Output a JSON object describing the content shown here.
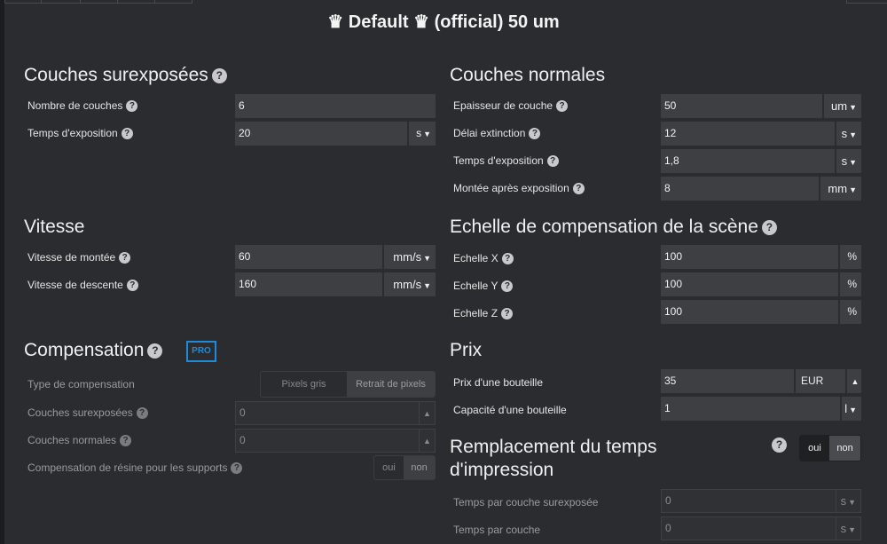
{
  "header": {
    "title": "♛ Default ♛ (official) 50 um"
  },
  "burn_layers": {
    "title": "Couches surexposées",
    "count_label": "Nombre de couches",
    "count_value": "6",
    "exposure_label": "Temps d'exposition",
    "exposure_value": "20",
    "exposure_unit": "s"
  },
  "normal_layers": {
    "title": "Couches normales",
    "thickness_label": "Epaisseur de couche",
    "thickness_value": "50",
    "thickness_unit": "um",
    "off_delay_label": "Délai extinction",
    "off_delay_value": "12",
    "off_delay_unit": "s",
    "exposure_label": "Temps d'exposition",
    "exposure_value": "1,8",
    "exposure_unit": "s",
    "lift_label": "Montée après exposition",
    "lift_value": "8",
    "lift_unit": "mm"
  },
  "speed": {
    "title": "Vitesse",
    "up_label": "Vitesse de montée",
    "up_value": "60",
    "up_unit": "mm/s",
    "down_label": "Vitesse de descente",
    "down_value": "160",
    "down_unit": "mm/s"
  },
  "scale": {
    "title": "Echelle de compensation de la scène",
    "x_label": "Echelle X",
    "x_value": "100",
    "x_unit": "%",
    "y_label": "Echelle Y",
    "y_value": "100",
    "y_unit": "%",
    "z_label": "Echelle Z",
    "z_value": "100",
    "z_unit": "%"
  },
  "compensation": {
    "title": "Compensation",
    "pro_badge": "PRO",
    "type_label": "Type de compensation",
    "type_option_1": "Pixels gris",
    "type_option_2": "Retrait de pixels",
    "burn_label": "Couches surexposées",
    "burn_value": "0",
    "normal_label": "Couches normales",
    "normal_value": "0",
    "support_label": "Compensation de résine pour les supports",
    "support_yes": "oui",
    "support_no": "non"
  },
  "price": {
    "title": "Prix",
    "bottle_price_label": "Prix d'une bouteille",
    "bottle_price_value": "35",
    "bottle_price_currency": "EUR",
    "bottle_capacity_label": "Capacité d'une bouteille",
    "bottle_capacity_value": "1",
    "bottle_capacity_unit": "l"
  },
  "time_override": {
    "title_line1": "Remplacement du temps",
    "title_line2": "d'impression",
    "yes": "oui",
    "no": "non",
    "burn_time_label": "Temps par couche surexposée",
    "burn_time_value": "0",
    "burn_time_unit": "s",
    "layer_time_label": "Temps par couche",
    "layer_time_value": "0",
    "layer_time_unit": "s"
  },
  "icons": {
    "help": "question-circle-icon",
    "dropdown": "caret-down-icon",
    "spinner": "caret-up-icon"
  },
  "colors": {
    "background": "#2b2c2f",
    "field": "#3e3f43",
    "accent": "#1f8ad8"
  }
}
